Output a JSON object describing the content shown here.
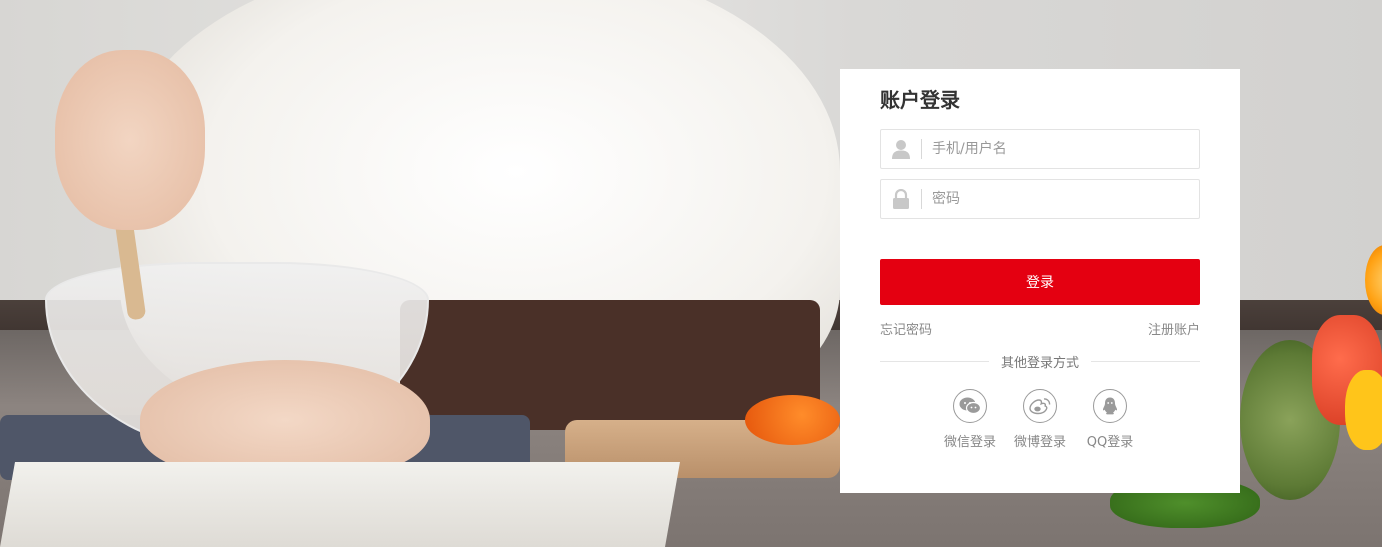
{
  "login": {
    "title": "账户登录",
    "username_placeholder": "手机/用户名",
    "password_placeholder": "密码",
    "submit_label": "登录",
    "forgot_password": "忘记密码",
    "register": "注册账户",
    "other_methods": "其他登录方式",
    "socials": [
      {
        "label": "微信登录",
        "icon": "wechat-icon"
      },
      {
        "label": "微博登录",
        "icon": "weibo-icon"
      },
      {
        "label": "QQ登录",
        "icon": "qq-icon"
      }
    ]
  },
  "colors": {
    "accent": "#e40011",
    "panel_bg": "#ffffff",
    "muted_text": "#888888"
  }
}
